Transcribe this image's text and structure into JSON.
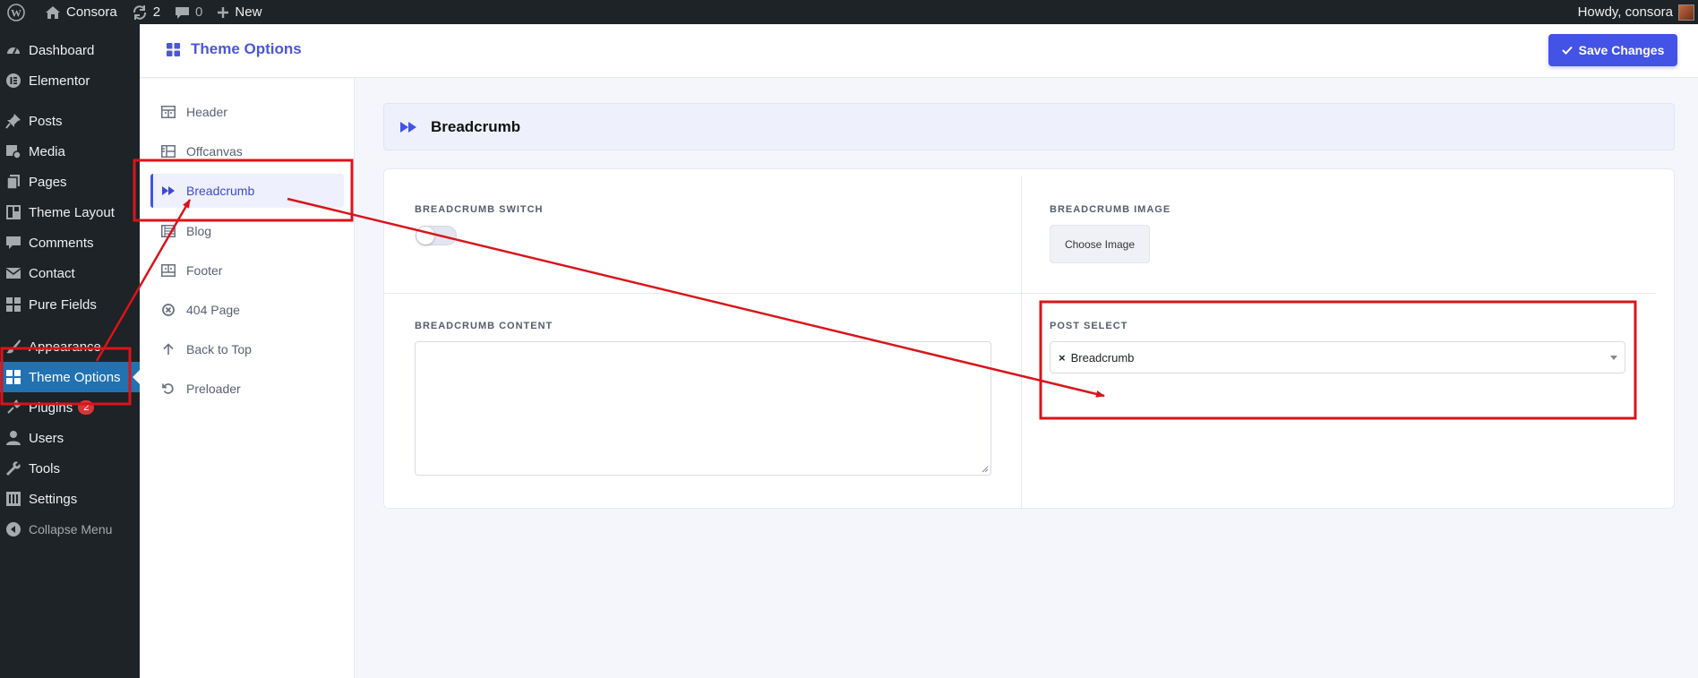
{
  "adminbar": {
    "site_name": "Consora",
    "updates_count": "2",
    "comments_count": "0",
    "new_label": "New",
    "greeting": "Howdy, consora"
  },
  "adminmenu": {
    "items": [
      {
        "label": "Dashboard",
        "icon": "dashboard-icon"
      },
      {
        "label": "Elementor",
        "icon": "elementor-icon"
      },
      {
        "label": "Posts",
        "icon": "pin-icon"
      },
      {
        "label": "Media",
        "icon": "media-icon"
      },
      {
        "label": "Pages",
        "icon": "pages-icon"
      },
      {
        "label": "Theme Layout",
        "icon": "layout-icon"
      },
      {
        "label": "Comments",
        "icon": "comment-icon"
      },
      {
        "label": "Contact",
        "icon": "mail-icon"
      },
      {
        "label": "Pure Fields",
        "icon": "grid-icon"
      },
      {
        "label": "Appearance",
        "icon": "brush-icon"
      },
      {
        "label": "Theme Options",
        "icon": "grid-icon"
      },
      {
        "label": "Plugins",
        "icon": "plug-icon",
        "badge": "2"
      },
      {
        "label": "Users",
        "icon": "user-icon"
      },
      {
        "label": "Tools",
        "icon": "wrench-icon"
      },
      {
        "label": "Settings",
        "icon": "settings-icon"
      },
      {
        "label": "Collapse Menu",
        "icon": "collapse-icon"
      }
    ],
    "active": "Theme Options"
  },
  "header": {
    "title": "Theme Options",
    "save_label": "Save Changes"
  },
  "optnav": {
    "items": [
      {
        "label": "Header",
        "icon": "header-icon"
      },
      {
        "label": "Offcanvas",
        "icon": "offcanvas-icon"
      },
      {
        "label": "Breadcrumb",
        "icon": "forward-icon"
      },
      {
        "label": "Blog",
        "icon": "blog-icon"
      },
      {
        "label": "Footer",
        "icon": "footer-icon"
      },
      {
        "label": "404 Page",
        "icon": "close-circle-icon"
      },
      {
        "label": "Back to Top",
        "icon": "arrow-up-icon"
      },
      {
        "label": "Preloader",
        "icon": "refresh-icon"
      }
    ],
    "active": "Breadcrumb"
  },
  "section": {
    "title": "Breadcrumb",
    "switch_label": "BREADCRUMB SWITCH",
    "switch_on": false,
    "image_label": "BREADCRUMB IMAGE",
    "choose_image_label": "Choose Image",
    "content_label": "BREADCRUMB CONTENT",
    "content_value": "",
    "post_select_label": "POST SELECT",
    "post_select_value": "Breadcrumb",
    "remove_symbol": "×"
  },
  "colors": {
    "accent": "#4353e6",
    "wp_active": "#2271b1",
    "annotation": "#d9141b"
  }
}
